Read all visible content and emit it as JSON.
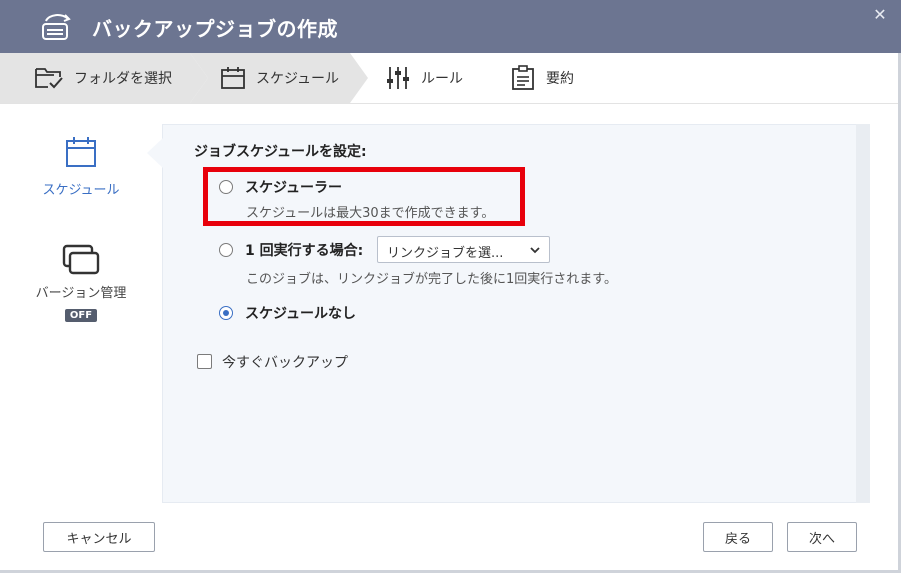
{
  "window": {
    "title": "バックアップジョブの作成",
    "close_glyph": "✕"
  },
  "steps": [
    {
      "label": "フォルダを選択",
      "icon": "folder-check-icon"
    },
    {
      "label": "スケジュール",
      "icon": "calendar-icon",
      "active": true
    },
    {
      "label": "ルール",
      "icon": "sliders-icon"
    },
    {
      "label": "要約",
      "icon": "clipboard-icon"
    }
  ],
  "sidebar": {
    "items": [
      {
        "label": "スケジュール",
        "icon": "calendar-icon",
        "active": true
      },
      {
        "label": "バージョン管理",
        "icon": "windows-stack-icon",
        "badge": "OFF"
      }
    ]
  },
  "schedule": {
    "heading": "ジョブスケジュールを設定:",
    "options": [
      {
        "label": "スケジューラー",
        "desc": "スケジュールは最大30まで作成できます。",
        "checked": false
      },
      {
        "label": "1 回実行する場合:",
        "desc": "このジョブは、リンクジョブが完了した後に1回実行されます。",
        "checked": false,
        "select_value": "リンクジョブを選..."
      },
      {
        "label": "スケジュールなし",
        "checked": true
      }
    ],
    "backup_now_label": "今すぐバックアップ",
    "backup_now_checked": false
  },
  "buttons": {
    "cancel": "キャンセル",
    "back": "戻る",
    "next": "次へ"
  },
  "colors": {
    "titlebar": "#6c7591",
    "accent": "#3a6fc4",
    "highlight": "#e8000b"
  }
}
